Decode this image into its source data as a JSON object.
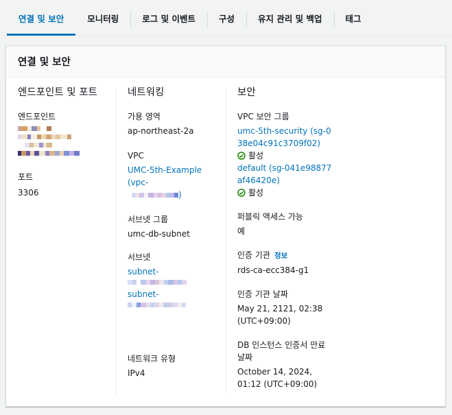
{
  "tabs": [
    {
      "label": "연결 및 보안",
      "active": true
    },
    {
      "label": "모니터링",
      "active": false
    },
    {
      "label": "로그 및 이벤트",
      "active": false
    },
    {
      "label": "구성",
      "active": false
    },
    {
      "label": "유지 관리 및 백업",
      "active": false
    },
    {
      "label": "태그",
      "active": false
    }
  ],
  "card": {
    "title": "연결 및 보안",
    "endpoint": {
      "heading": "엔드포인트 및 포트",
      "endpoint_label": "엔드포인트",
      "port_label": "포트",
      "port_value": "3306"
    },
    "networking": {
      "heading": "네트워킹",
      "az_label": "가용 영역",
      "az_value": "ap-northeast-2a",
      "vpc_label": "VPC",
      "vpc_link": "UMC-5th-Example",
      "vpc_prefix": "(vpc-",
      "vpc_suffix": ")",
      "subnet_group_label": "서브넷 그룹",
      "subnet_group_value": "umc-db-subnet",
      "subnets_label": "서브넷",
      "subnet_prefix_1": "subnet-",
      "subnet_prefix_2": "subnet-",
      "network_type_label": "네트워크 유형",
      "network_type_value": "IPv4"
    },
    "security": {
      "heading": "보안",
      "sg_label": "VPC 보안 그룹",
      "sg1_link": "umc-5th-security (sg-038e04c91c3709f02)",
      "sg1_status": "활성",
      "sg2_link": "default (sg-041e98877af46420e)",
      "sg2_status": "활성",
      "public_label": "퍼블릭 액세스 가능",
      "public_value": "예",
      "ca_label": "인증 기관",
      "ca_info": "정보",
      "ca_value": "rds-ca-ecc384-g1",
      "ca_date_label": "인증 기관 날짜",
      "ca_date_value": "May 21, 2121, 02:38 (UTC+09:00)",
      "cert_expiry_label": "DB 인스턴스 인증서 만료 날짜",
      "cert_expiry_value": "October 14, 2024, 01:12 (UTC+09:00)"
    }
  },
  "colors": {
    "accent": "#0073bb",
    "success": "#1d8102",
    "text": "#16191f",
    "background": "#f2f3f3",
    "border": "#d5dbdb"
  }
}
